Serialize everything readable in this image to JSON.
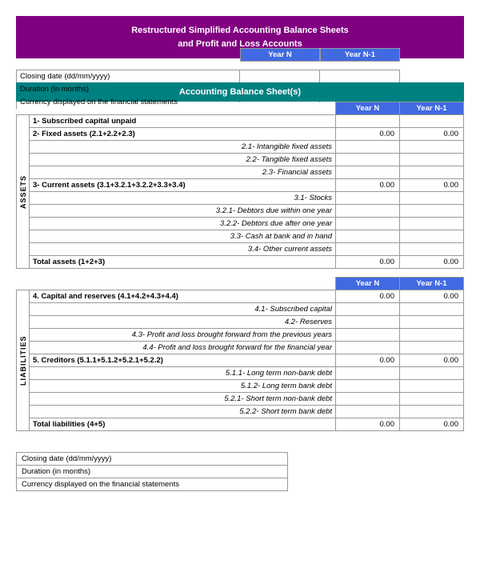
{
  "title": {
    "line1": "Restructured Simplified Accounting Balance Sheets",
    "line2": "and Profit and Loss Accounts"
  },
  "info_section": {
    "rows": [
      {
        "label": "Closing date (dd/mm/yyyy)"
      },
      {
        "label": "Duration (in months)"
      },
      {
        "label": "Currency displayed on the financial statements"
      }
    ]
  },
  "balance_sheet_title": "Accounting Balance Sheet(s)",
  "col_year": "Year N",
  "col_yearn1": "Year N-1",
  "assets_label": "ASSETS",
  "liabilities_label": "LIABILITIES",
  "assets_rows": [
    {
      "type": "bold",
      "label": "1- Subscribed capital unpaid",
      "val_n": "",
      "val_n1": ""
    },
    {
      "type": "bold",
      "label": "2- Fixed assets (2.1+2.2+2.3)",
      "val_n": "0.00",
      "val_n1": "0.00"
    },
    {
      "type": "italic",
      "label": "2.1- Intangible fixed assets",
      "val_n": "",
      "val_n1": ""
    },
    {
      "type": "italic",
      "label": "2.2- Tangible fixed assets",
      "val_n": "",
      "val_n1": ""
    },
    {
      "type": "italic",
      "label": "2.3- Financial assets",
      "val_n": "",
      "val_n1": ""
    },
    {
      "type": "bold",
      "label": "3- Current assets (3.1+3.2.1+3.2.2+3.3+3.4)",
      "val_n": "0.00",
      "val_n1": "0.00"
    },
    {
      "type": "italic",
      "label": "3.1- Stocks",
      "val_n": "",
      "val_n1": ""
    },
    {
      "type": "italic",
      "label": "3.2.1- Debtors due within one year",
      "val_n": "",
      "val_n1": ""
    },
    {
      "type": "italic",
      "label": "3.2.2- Debtors due after one year",
      "val_n": "",
      "val_n1": ""
    },
    {
      "type": "italic",
      "label": "3.3- Cash at bank and in hand",
      "val_n": "",
      "val_n1": ""
    },
    {
      "type": "italic",
      "label": "3.4- Other current assets",
      "val_n": "",
      "val_n1": ""
    },
    {
      "type": "total",
      "label": "Total assets (1+2+3)",
      "val_n": "0.00",
      "val_n1": "0.00"
    }
  ],
  "liabilities_rows": [
    {
      "type": "bold",
      "label": "4. Capital and reserves (4.1+4.2+4.3+4.4)",
      "val_n": "0.00",
      "val_n1": "0.00"
    },
    {
      "type": "italic",
      "label": "4.1- Subscribed capital",
      "val_n": "",
      "val_n1": ""
    },
    {
      "type": "italic",
      "label": "4.2- Reserves",
      "val_n": "",
      "val_n1": ""
    },
    {
      "type": "italic",
      "label": "4.3- Profit and loss brought forward from the previous years",
      "val_n": "",
      "val_n1": ""
    },
    {
      "type": "italic",
      "label": "4.4- Profit and loss brought forward for the financial year",
      "val_n": "",
      "val_n1": ""
    },
    {
      "type": "bold",
      "label": "5. Creditors (5.1.1+5.1.2+5.2.1+5.2.2)",
      "val_n": "0.00",
      "val_n1": "0.00"
    },
    {
      "type": "italic",
      "label": "5.1.1- Long term non-bank debt",
      "val_n": "",
      "val_n1": ""
    },
    {
      "type": "italic",
      "label": "5.1.2- Long term bank debt",
      "val_n": "",
      "val_n1": ""
    },
    {
      "type": "italic",
      "label": "5.2.1- Short term non-bank debt",
      "val_n": "",
      "val_n1": ""
    },
    {
      "type": "italic",
      "label": "5.2.2- Short term bank debt",
      "val_n": "",
      "val_n1": ""
    },
    {
      "type": "total",
      "label": "Total liabilities (4+5)",
      "val_n": "0.00",
      "val_n1": "0.00"
    }
  ],
  "bottom_section": {
    "rows": [
      {
        "label": "Closing date (dd/mm/yyyy)"
      },
      {
        "label": "Duration (in months)"
      },
      {
        "label": "Currency displayed on the financial statements"
      }
    ]
  }
}
